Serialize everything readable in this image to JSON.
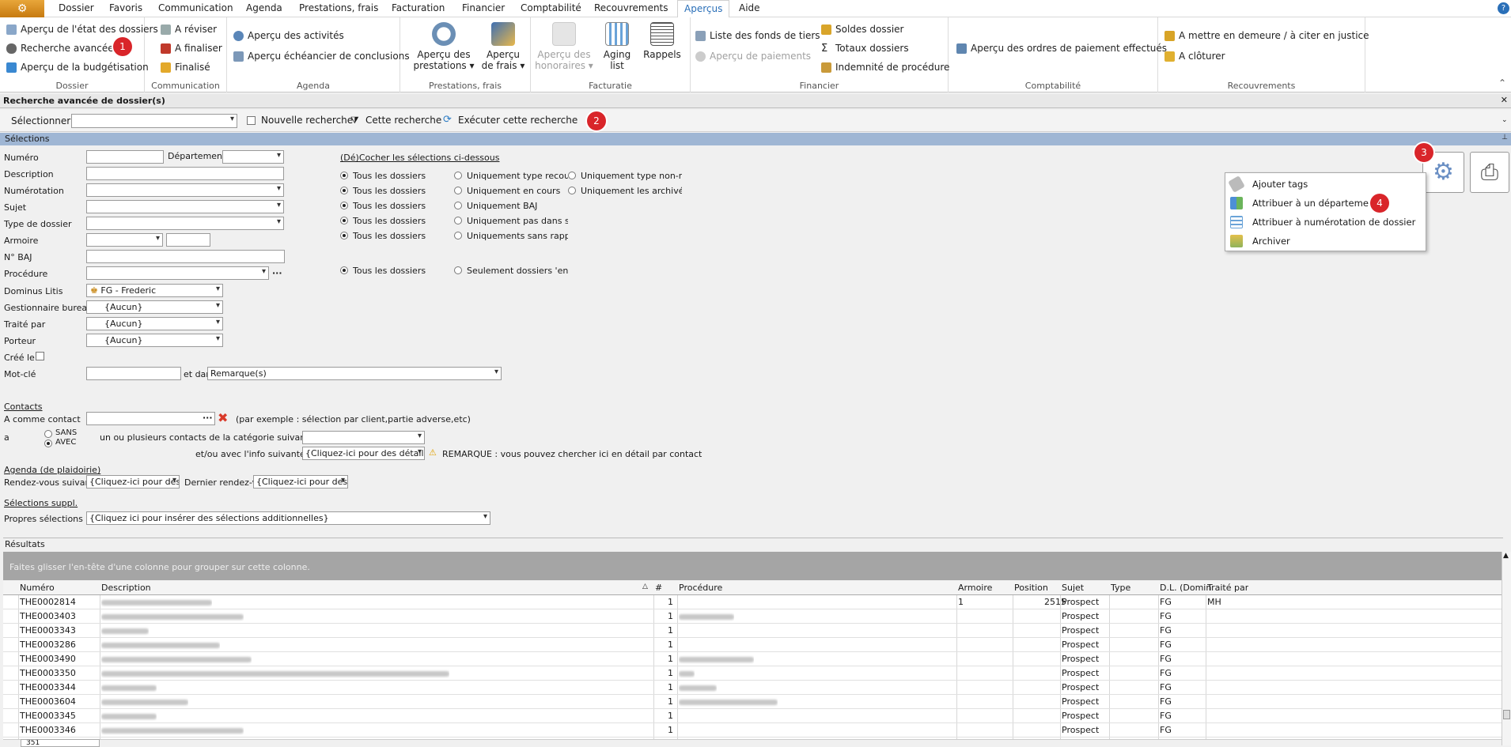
{
  "menubar": {
    "tabs": [
      "Dossier",
      "Favoris",
      "Communication",
      "Agenda",
      "Prestations, frais",
      "Facturation",
      "Financier",
      "Comptabilité",
      "Recouvrements",
      "Aperçus",
      "Aide"
    ],
    "active": "Aperçus"
  },
  "ribbon": {
    "dossier": {
      "label": "Dossier",
      "items": [
        "Aperçu de l'état des dossiers",
        "Recherche avancée",
        "Aperçu de la budgétisation"
      ]
    },
    "communication": {
      "label": "Communication",
      "items": [
        "A réviser",
        "A finaliser",
        "Finalisé"
      ]
    },
    "agenda": {
      "label": "Agenda",
      "items": [
        "Aperçu des activités",
        "Aperçu échéancier de conclusions"
      ]
    },
    "prestations": {
      "label": "Prestations, frais",
      "btn1": "Aperçu des prestations",
      "btn2": "Aperçu de frais"
    },
    "facturation": {
      "label": "Facturatie",
      "btn1": "Aperçu des honoraires",
      "btn2": "Aging list",
      "btn3": "Rappels"
    },
    "financier": {
      "label": "Financier",
      "items": [
        "Liste des fonds de tiers",
        "Aperçu de paiements"
      ],
      "items2": [
        "Soldes dossier",
        "Totaux dossiers",
        "Indemnité de procédure"
      ]
    },
    "comptabilite": {
      "label": "Comptabilité",
      "items": [
        "Aperçu des ordres de paiement effectués"
      ]
    },
    "recouvrements": {
      "label": "Recouvrements",
      "items": [
        "A mettre en demeure / à citer en justice",
        "A clôturer"
      ]
    }
  },
  "badges": [
    "1",
    "2",
    "3",
    "4"
  ],
  "panel": {
    "title": "Recherche avancée de dossier(s)"
  },
  "toolbar": {
    "select_label": "Sélectionner",
    "new_search": "Nouvelle recherche",
    "this_search": "Cette recherche",
    "execute": "Exécuter cette recherche"
  },
  "selections": {
    "header": "Sélections",
    "fields": {
      "numero": "Numéro",
      "departement": "Département",
      "description": "Description",
      "numerotation": "Numérotation",
      "sujet": "Sujet",
      "type_dossier": "Type de dossier",
      "armoire": "Armoire",
      "baj": "N° BAJ",
      "procedure": "Procédure",
      "dominus": "Dominus Litis",
      "dominus_value": "FG - Frederic",
      "gestionnaire": "Gestionnaire bureau",
      "gestionnaire_value": "{Aucun}",
      "traite_par": "Traité par",
      "traite_value": "{Aucun}",
      "porteur": "Porteur",
      "porteur_value": "{Aucun}",
      "cree_le": "Créé le",
      "mot_cle": "Mot-clé",
      "et_dans": "et dan",
      "remarque": "Remarque(s)"
    },
    "toggle_heading": "(Dé)Cocher les sélections ci-dessous",
    "col1": [
      "Tous les dossiers",
      "Tous les dossiers",
      "Tous les dossiers",
      "Tous les dossiers",
      "Tous les dossiers",
      "Tous les dossiers"
    ],
    "col2": [
      "Uniquement type recouvre",
      "Uniquement en cours",
      "Uniquement BAJ",
      "Uniquement pas dans sold",
      "Uniquements sans rappel(s",
      "Seulement dossiers 'en sus"
    ],
    "col3": [
      "Uniquement type non-reco",
      "Uniquement les archivés"
    ]
  },
  "contacts": {
    "heading": "Contacts",
    "a_comme_contact": "A comme contact",
    "example": "(par exemple : sélection par client,partie adverse,etc)",
    "a": "a",
    "sans": "SANS",
    "avec": "AVEC",
    "categorie": "un ou plusieurs contacts de la catégorie suivante",
    "info": "et/ou avec l'info suivante",
    "details": "{Cliquez-ici pour des détails}",
    "remarque": "REMARQUE : vous pouvez chercher ici en détail par contact"
  },
  "agenda_sel": {
    "heading": "Agenda (de plaidoirie)",
    "rdv": "Rendez-vous suivant",
    "rdv_value": "{Cliquez-ici pour des",
    "last": "Dernier rendez-vo",
    "last_value": "{Cliquez-ici pour des"
  },
  "suppl": {
    "heading": "Sélections suppl.",
    "own": "Propres sélections",
    "own_value": "{Cliquez ici pour insérer des sélections additionnelles}"
  },
  "context_menu": [
    "Ajouter tags",
    "Attribuer à un département",
    "Attribuer à numérotation de dossier",
    "Archiver"
  ],
  "results": {
    "header": "Résultats",
    "group_hint": "Faites glisser l'en-tête d'une colonne pour grouper sur cette colonne.",
    "columns": [
      "Numéro",
      "Description",
      "#",
      "Procédure",
      "Armoire",
      "Position",
      "Sujet",
      "Type",
      "D.L. (Domin",
      "Traité par"
    ],
    "rows": [
      {
        "num": "THE0002814",
        "hash": "1",
        "armoire": "1",
        "position": "2515",
        "sujet": "Prospect",
        "dl": "FG",
        "traite": "MH"
      },
      {
        "num": "THE0003403",
        "hash": "1",
        "armoire": "",
        "position": "",
        "sujet": "Prospect",
        "dl": "FG",
        "traite": ""
      },
      {
        "num": "THE0003343",
        "hash": "1",
        "armoire": "",
        "position": "",
        "sujet": "Prospect",
        "dl": "FG",
        "traite": ""
      },
      {
        "num": "THE0003286",
        "hash": "1",
        "armoire": "",
        "position": "",
        "sujet": "Prospect",
        "dl": "FG",
        "traite": ""
      },
      {
        "num": "THE0003490",
        "hash": "1",
        "armoire": "",
        "position": "",
        "sujet": "Prospect",
        "dl": "FG",
        "traite": ""
      },
      {
        "num": "THE0003350",
        "hash": "1",
        "armoire": "",
        "position": "",
        "sujet": "Prospect",
        "dl": "FG",
        "traite": ""
      },
      {
        "num": "THE0003344",
        "hash": "1",
        "armoire": "",
        "position": "",
        "sujet": "Prospect",
        "dl": "FG",
        "traite": ""
      },
      {
        "num": "THE0003604",
        "hash": "1",
        "armoire": "",
        "position": "",
        "sujet": "Prospect",
        "dl": "FG",
        "traite": ""
      },
      {
        "num": "THE0003345",
        "hash": "1",
        "armoire": "",
        "position": "",
        "sujet": "Prospect",
        "dl": "FG",
        "traite": ""
      },
      {
        "num": "THE0003346",
        "hash": "1",
        "armoire": "",
        "position": "",
        "sujet": "Prospect",
        "dl": "FG",
        "traite": ""
      }
    ],
    "footer_count": "351"
  }
}
